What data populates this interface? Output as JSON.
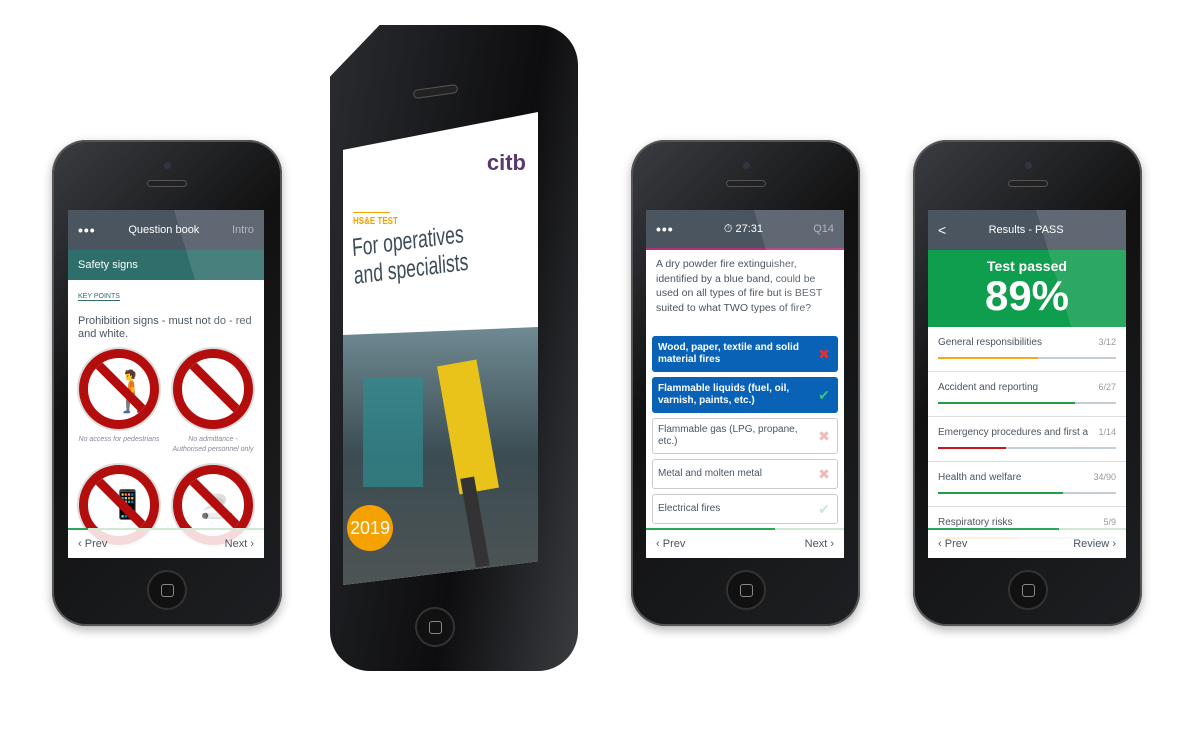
{
  "phone_book": {
    "menu": "•••",
    "title": "Question book",
    "right": "Intro",
    "section": "Safety signs",
    "key_points": "KEY POINTS",
    "text": "Prohibition signs - must not do - red and white.",
    "signs": [
      {
        "caption": "No access for pedestrians",
        "icon": "pedestrian-icon"
      },
      {
        "caption": "No admittance - Authorised personnel only",
        "icon": ""
      },
      {
        "caption": "",
        "icon": "mobile-phone-icon"
      },
      {
        "caption": "",
        "icon": "cigarette-icon"
      }
    ],
    "prev": "Prev",
    "next": "Next",
    "progress": 0.1
  },
  "cover": {
    "logo": "citb",
    "label": "HS&E TEST",
    "title": "For operatives and specialists",
    "year": "2019",
    "accent": "#f5a100"
  },
  "phone_question": {
    "menu": "•••",
    "timer": "27:31",
    "qnum": "Q14",
    "question": "A dry powder fire extinguisher, identified by a blue band, could be used on all types of fire but is BEST suited to what TWO types of fire?",
    "answers": [
      {
        "text": "Wood, paper, textile and solid material fires",
        "selected": true,
        "mark": "cross"
      },
      {
        "text": "Flammable liquids (fuel, oil, varnish, paints, etc.)",
        "selected": true,
        "mark": "check"
      },
      {
        "text": "Flammable gas (LPG, propane, etc.)",
        "selected": false,
        "mark": "cross"
      },
      {
        "text": "Metal and molten metal",
        "selected": false,
        "mark": "cross"
      },
      {
        "text": "Electrical fires",
        "selected": false,
        "mark": "check"
      }
    ],
    "prev": "Prev",
    "next": "Next",
    "progress": 0.65
  },
  "phone_results": {
    "back": "<",
    "title": "Results - PASS",
    "status": "Test passed",
    "score": "89%",
    "categories": [
      {
        "name": "General responsibilities",
        "score": "3/12",
        "fill": 0.56,
        "color": "#f5a623"
      },
      {
        "name": "Accident and reporting",
        "score": "6/27",
        "fill": 0.77,
        "color": "#1f9e4a"
      },
      {
        "name": "Emergency procedures and first aid",
        "score": "1/14",
        "fill": 0.38,
        "color": "#c8161d"
      },
      {
        "name": "Health and welfare",
        "score": "34/90",
        "fill": 0.7,
        "color": "#1f9e4a"
      },
      {
        "name": "Respiratory risks",
        "score": "5/9",
        "fill": 0.45,
        "color": "#f5a623"
      }
    ],
    "prev": "Prev",
    "review": "Review",
    "progress": 0.66
  }
}
